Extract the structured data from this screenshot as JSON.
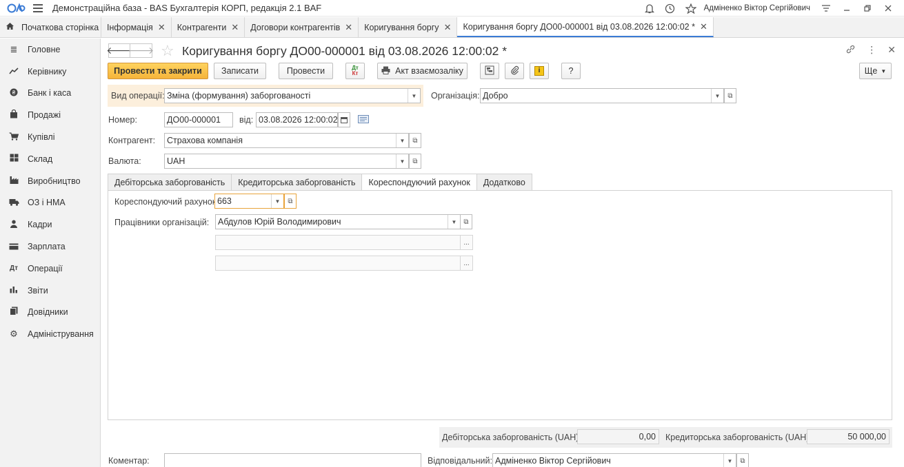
{
  "app": {
    "title": "Демонстраційна база - BAS Бухгалтерія КОРП, редакція 2.1 BAF",
    "user": "Адміненко Віктор Сергійович"
  },
  "tabs": {
    "home": "Початкова сторінка",
    "items": [
      "Інформація",
      "Контрагенти",
      "Договори контрагентів",
      "Коригування боргу",
      "Коригування боргу ДО00-000001 від 03.08.2026 12:00:02 *"
    ]
  },
  "sidebar": {
    "items": [
      "Головне",
      "Керівнику",
      "Банк і каса",
      "Продажі",
      "Купівлі",
      "Склад",
      "Виробництво",
      "ОЗ і НМА",
      "Кадри",
      "Зарплата",
      "Операції",
      "Звіти",
      "Довідники",
      "Адміністрування"
    ]
  },
  "doc": {
    "title": "Коригування боргу ДО00-000001 від 03.08.2026 12:00:02 *"
  },
  "toolbar": {
    "post_close": "Провести та закрити",
    "save": "Записати",
    "post": "Провести",
    "dt_kt": "Дт Кт",
    "act": "Акт взаємозаліку",
    "help": "?",
    "more": "Ще"
  },
  "form": {
    "op_type_label": "Вид операції:",
    "op_type_value": "Зміна (формування) заборгованості",
    "org_label": "Організація:",
    "org_value": "Добро",
    "number_label": "Номер:",
    "number_value": "ДО00-000001",
    "from_label": "від:",
    "date_value": "03.08.2026 12:00:02",
    "counterparty_label": "Контрагент:",
    "counterparty_value": "Страхова компанія",
    "currency_label": "Валюта:",
    "currency_value": "UAH"
  },
  "form_tabs": [
    "Дебіторська заборгованість",
    "Кредиторська заборгованість",
    "Кореспондуючий рахунок",
    "Додатково"
  ],
  "corr": {
    "account_label": "Кореспондуючий рахунок",
    "account_value": "663",
    "employees_label": "Працівники організацій:",
    "employees_value": "Абдулов Юрій Володимирович",
    "sub1": "",
    "sub2": "",
    "ellipsis": "..."
  },
  "totals": {
    "debit_label": "Дебіторська заборгованість (UAH):",
    "debit_value": "0,00",
    "credit_label": "Кредиторська заборгованість (UAH):",
    "credit_value": "50 000,00"
  },
  "footer": {
    "comment_label": "Коментар:",
    "comment_value": "",
    "responsible_label": "Відповідальний:",
    "responsible_value": "Адміненко Віктор Сергійович"
  }
}
